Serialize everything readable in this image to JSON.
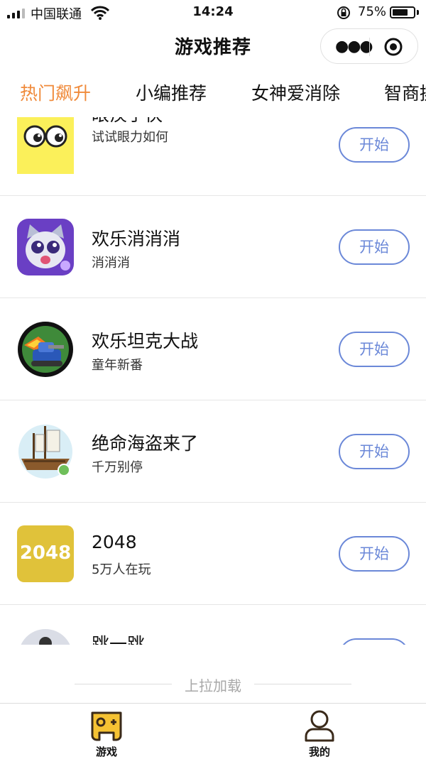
{
  "status_bar": {
    "carrier": "中国联通",
    "time": "14:24",
    "battery_pct": "75%",
    "battery_level": 0.75
  },
  "nav": {
    "title": "游戏推荐"
  },
  "tabs": [
    {
      "label": "热门飙升",
      "active": true
    },
    {
      "label": "小编推荐",
      "active": false
    },
    {
      "label": "女神爱消除",
      "active": false
    },
    {
      "label": "智商挑",
      "active": false
    }
  ],
  "games": [
    {
      "name": "眼疾手快",
      "desc": "试试眼力如何",
      "button": "开始",
      "icon": "eyes-icon"
    },
    {
      "name": "欢乐消消消",
      "desc": "消消消",
      "button": "开始",
      "icon": "cat-icon"
    },
    {
      "name": "欢乐坦克大战",
      "desc": "童年新番",
      "button": "开始",
      "icon": "tank-icon"
    },
    {
      "name": "绝命海盗来了",
      "desc": "千万别停",
      "button": "开始",
      "icon": "pirate-ship-icon"
    },
    {
      "name": "2048",
      "desc": "5万人在玩",
      "button": "开始",
      "icon": "2048-icon",
      "icon_text": "2048"
    },
    {
      "name": "跳一跳",
      "desc": "",
      "button": "",
      "icon": "jump-icon"
    }
  ],
  "load_more": "上拉加载",
  "tabbar": [
    {
      "label": "游戏",
      "icon": "gamepad-icon"
    },
    {
      "label": "我的",
      "icon": "user-icon"
    }
  ]
}
